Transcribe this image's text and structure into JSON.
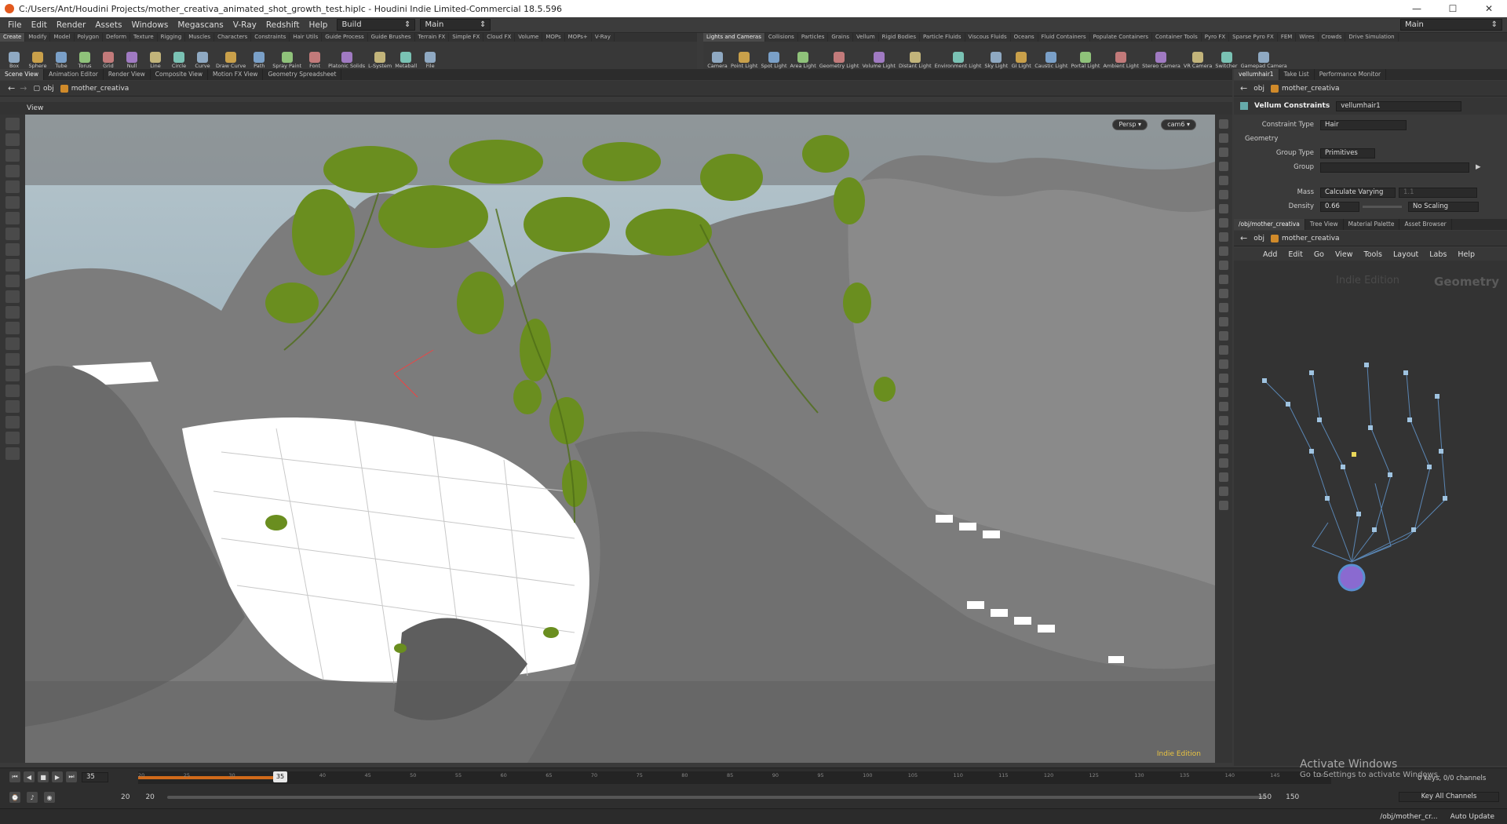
{
  "window": {
    "title": "C:/Users/Ant/Houdini Projects/mother_creativa_animated_shot_growth_test.hiplc - Houdini Indie Limited-Commercial 18.5.596",
    "minimize": "—",
    "maximize": "☐",
    "close": "✕"
  },
  "menubar": {
    "items": [
      "File",
      "Edit",
      "Render",
      "Assets",
      "Windows",
      "Megascans",
      "V-Ray",
      "Redshift",
      "Help"
    ],
    "desktop": "Build",
    "desktop_right": "Main",
    "desktop_main": "Main"
  },
  "shelf_left": {
    "tabs": [
      "Create",
      "Modify",
      "Model",
      "Polygon",
      "Deform",
      "Texture",
      "Rigging",
      "Muscles",
      "Characters",
      "Constraints",
      "Hair Utils",
      "Guide Process",
      "Guide Brushes",
      "Terrain FX",
      "Simple FX",
      "Cloud FX",
      "Volume",
      "MOPs",
      "MOPs+",
      "V-Ray"
    ],
    "tools": [
      "Box",
      "Sphere",
      "Tube",
      "Torus",
      "Grid",
      "Null",
      "Line",
      "Circle",
      "Curve",
      "Draw Curve",
      "Path",
      "Spray Paint",
      "Font",
      "Platonic Solids",
      "L-System",
      "Metaball",
      "File"
    ]
  },
  "shelf_right": {
    "tabs": [
      "Lights and Cameras",
      "Collisions",
      "Particles",
      "Grains",
      "Vellum",
      "Rigid Bodies",
      "Particle Fluids",
      "Viscous Fluids",
      "Oceans",
      "Fluid Containers",
      "Populate Containers",
      "Container Tools",
      "Pyro FX",
      "Sparse Pyro FX",
      "FEM",
      "Wires",
      "Crowds",
      "Drive Simulation"
    ],
    "tools": [
      "Camera",
      "Point Light",
      "Spot Light",
      "Area Light",
      "Geometry Light",
      "Volume Light",
      "Distant Light",
      "Environment Light",
      "Sky Light",
      "GI Light",
      "Caustic Light",
      "Portal Light",
      "Ambient Light",
      "Stereo Camera",
      "VR Camera",
      "Switcher",
      "Gamepad Camera"
    ]
  },
  "pane_tabs_main": [
    "Scene View",
    "Animation Editor",
    "Render View",
    "Composite View",
    "Motion FX View",
    "Geometry Spreadsheet"
  ],
  "pane_tabs_param": [
    "vellumhair1",
    "Take List",
    "Performance Monitor"
  ],
  "pane_tabs_net": [
    "/obj/mother_creativa",
    "Tree View",
    "Material Palette",
    "Asset Browser"
  ],
  "path": {
    "root": "obj",
    "node": "mother_creativa"
  },
  "viewport": {
    "label": "View",
    "persp": "Persp ▾",
    "cam": "cam6 ▾",
    "watermark": "Indie Edition",
    "colors": {
      "sky": "#9fb3bd",
      "rock": "#7b7b7b",
      "leaf": "#6a8e1f",
      "floor": "#ffffff"
    }
  },
  "params": {
    "node_type": "Vellum Constraints",
    "node_name": "vellumhair1",
    "constraint_type_label": "Constraint Type",
    "constraint_type_value": "Hair",
    "section": "Geometry",
    "group_type_label": "Group Type",
    "group_type_value": "Primitives",
    "group_label": "Group",
    "group_value": "",
    "mass_label": "Mass",
    "mass_value": "Calculate Varying",
    "mass_number": "1.1",
    "density_label": "Density",
    "density_value": "0.66",
    "scaling_value": "No Scaling"
  },
  "network": {
    "menu": [
      "Add",
      "Edit",
      "Go",
      "View",
      "Tools",
      "Layout",
      "Labs",
      "Help"
    ],
    "edition": "Indie Edition",
    "context": "Geometry"
  },
  "timeline": {
    "current_frame": "35",
    "ruler_cursor": "35",
    "start": "20",
    "start2": "20",
    "end": "150",
    "end2": "150",
    "ticks": [
      "20",
      "25",
      "30",
      "35",
      "40",
      "45",
      "50",
      "55",
      "60",
      "65",
      "70",
      "75",
      "80",
      "85",
      "90",
      "95",
      "100",
      "105",
      "110",
      "115",
      "120",
      "125",
      "130",
      "135",
      "140",
      "145",
      "150"
    ],
    "keys_info": "0 keys, 0/0 channels",
    "key_all": "Key All Channels",
    "auto_update": "Auto Update",
    "status_path": "/obj/mother_cr..."
  },
  "activate": {
    "title": "Activate Windows",
    "sub": "Go to Settings to activate Windows."
  }
}
